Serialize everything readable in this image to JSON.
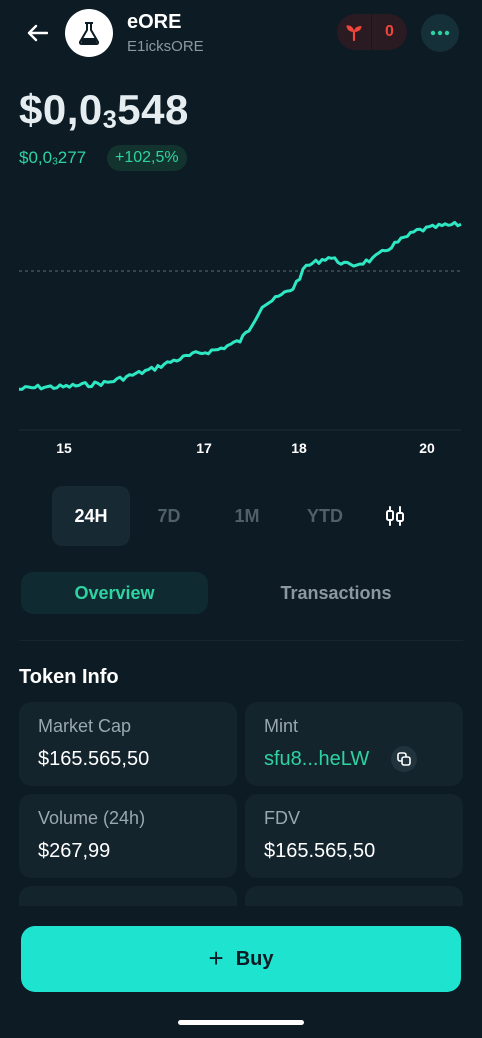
{
  "header": {
    "token_name": "eORE",
    "token_address": "E1icksORE",
    "favorite_count": "0",
    "icons": {
      "back": "back-arrow-icon",
      "logo": "flask-icon",
      "favorite": "sprout-icon",
      "more": "more-dots-icon"
    }
  },
  "price": {
    "prefix": "$0,0",
    "subscript": "3",
    "digits": "548"
  },
  "previous_price": {
    "prefix": "$0,0",
    "subscript": "3",
    "digits": "277"
  },
  "change": "+102,5%",
  "chart_data": {
    "type": "line",
    "title": "",
    "xlabel": "",
    "ylabel": "",
    "x_ticks": [
      "15",
      "17",
      "18",
      "20"
    ],
    "x": [
      0,
      0.05,
      0.1,
      0.15,
      0.2,
      0.25,
      0.3,
      0.35,
      0.4,
      0.45,
      0.5,
      0.52,
      0.55,
      0.58,
      0.62,
      0.65,
      0.7,
      0.75,
      0.8,
      0.85,
      0.9,
      0.95,
      1.0
    ],
    "series": [
      {
        "values": [
          0.14,
          0.15,
          0.15,
          0.16,
          0.17,
          0.2,
          0.23,
          0.27,
          0.3,
          0.32,
          0.36,
          0.41,
          0.52,
          0.55,
          0.6,
          0.7,
          0.74,
          0.7,
          0.73,
          0.8,
          0.86,
          0.88,
          0.89
        ]
      }
    ],
    "reference_line": "dashed",
    "line_color": "#2ee8c4"
  },
  "range_tabs": [
    "24H",
    "7D",
    "1M",
    "YTD"
  ],
  "active_range": "24H",
  "candlestick_icon": "candlestick-icon",
  "view_tabs": {
    "overview": "Overview",
    "transactions": "Transactions"
  },
  "token_info": {
    "title": "Token Info",
    "market_cap_label": "Market Cap",
    "market_cap_value": "$165.565,50",
    "mint_label": "Mint",
    "mint_value": "sfu8...heLW",
    "volume_label": "Volume (24h)",
    "volume_value": "$267,99",
    "fdv_label": "FDV",
    "fdv_value": "$165.565,50",
    "copy_icon": "copy-icon"
  },
  "buy_label": "Buy",
  "colors": {
    "accent": "#2fd3a2",
    "buy": "#1ee3cf",
    "background": "#0c1b24",
    "favorite": "#f0453a"
  }
}
